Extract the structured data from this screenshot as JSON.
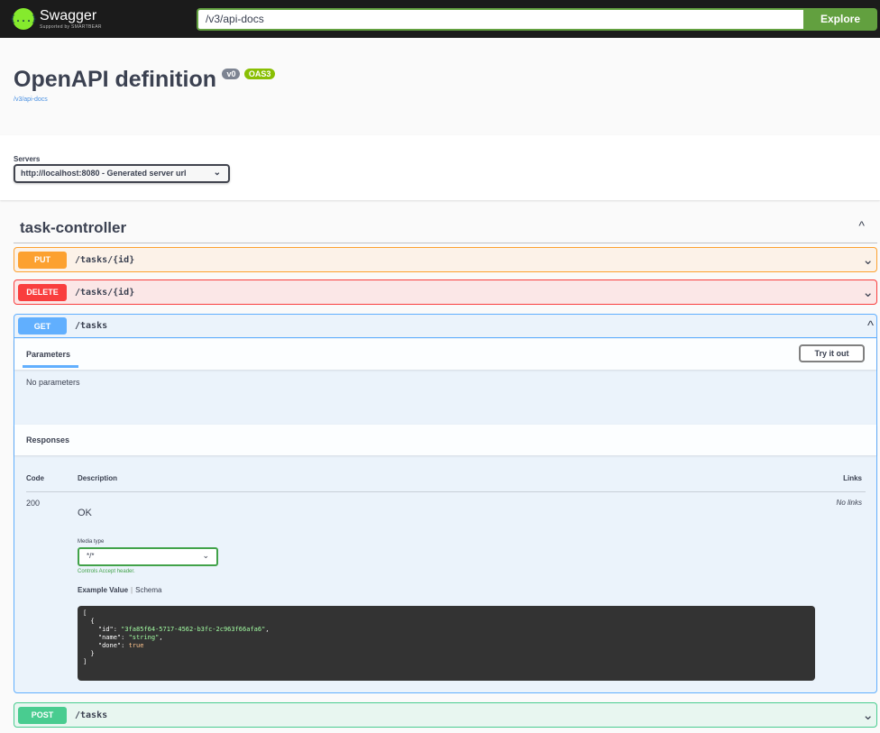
{
  "topbar": {
    "brand_name": "Swagger",
    "brand_sub": "Supported by SMARTBEAR",
    "logo_glyph": "{...}",
    "url_value": "/v3/api-docs",
    "explore_label": "Explore"
  },
  "info": {
    "title": "OpenAPI definition",
    "version_badge": "v0",
    "oas_badge": "OAS3",
    "spec_link": "/v3/api-docs"
  },
  "servers": {
    "label": "Servers",
    "selected": "http://localhost:8080 - Generated server url",
    "chevron": "⌄"
  },
  "tag": {
    "name": "task-controller",
    "toggle_glyph": "^"
  },
  "operations": [
    {
      "method": "PUT",
      "path": "/tasks/{id}",
      "arrow": "⌄",
      "expanded": false
    },
    {
      "method": "DELETE",
      "path": "/tasks/{id}",
      "arrow": "⌄",
      "expanded": false
    },
    {
      "method": "GET",
      "path": "/tasks",
      "arrow": "^",
      "expanded": true,
      "parameters_tab": "Parameters",
      "try_it_label": "Try it out",
      "no_params": "No parameters",
      "responses_title": "Responses",
      "columns": {
        "code": "Code",
        "description": "Description",
        "links": "Links"
      },
      "response": {
        "code": "200",
        "description": "OK",
        "links": "No links",
        "media_type_label": "Media type",
        "media_type_value": "*/*",
        "controls_note": "Controls Accept header.",
        "example_tab": "Example Value",
        "schema_tab": "Schema",
        "example": {
          "id": "3fa85f64-5717-4562-b3fc-2c963f66afa6",
          "name": "string",
          "done": "true"
        }
      }
    },
    {
      "method": "POST",
      "path": "/tasks",
      "arrow": "⌄",
      "expanded": false
    }
  ],
  "colors": {
    "put": "#fca130",
    "delete": "#f93e3e",
    "get": "#61affe",
    "post": "#49cc90",
    "explore": "#62a03f"
  },
  "icons": {
    "logo": "swagger-logo-icon",
    "chevron": "chevron-down-icon",
    "collapse": "chevron-up-icon"
  }
}
